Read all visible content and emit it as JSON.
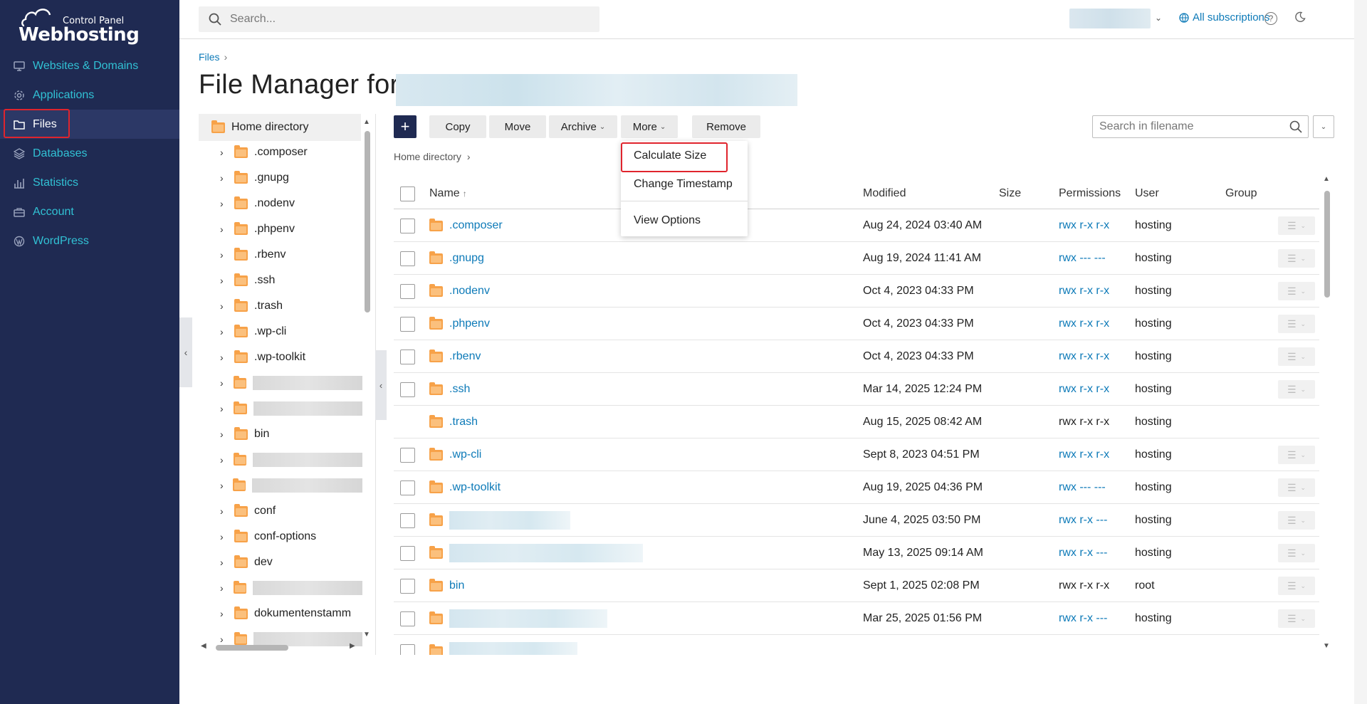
{
  "brand": {
    "line1": "Control Panel",
    "line2": "Webhosting"
  },
  "sidebar": {
    "items": [
      {
        "label": "Websites & Domains",
        "icon": "monitor-icon"
      },
      {
        "label": "Applications",
        "icon": "gear-icon"
      },
      {
        "label": "Files",
        "icon": "folder-icon",
        "active": true
      },
      {
        "label": "Databases",
        "icon": "layers-icon"
      },
      {
        "label": "Statistics",
        "icon": "bar-chart-icon"
      },
      {
        "label": "Account",
        "icon": "briefcase-icon"
      },
      {
        "label": "WordPress",
        "icon": "wordpress-icon"
      }
    ]
  },
  "topbar": {
    "search_placeholder": "Search...",
    "subscriptions_label": "All subscriptions"
  },
  "heading": {
    "breadcrumb": "Files",
    "title": "File Manager for"
  },
  "tree": {
    "root": "Home directory",
    "items": [
      ".composer",
      ".gnupg",
      ".nodenv",
      ".phpenv",
      ".rbenv",
      ".ssh",
      ".trash",
      ".wp-cli",
      ".wp-toolkit",
      "",
      "",
      "bin",
      "",
      "",
      "conf",
      "conf-options",
      "dev",
      "",
      "dokumentenstamm",
      ""
    ]
  },
  "toolbar": {
    "add_label": "+",
    "copy": "Copy",
    "move": "Move",
    "archive": "Archive",
    "more": "More",
    "remove": "Remove",
    "filename_search_placeholder": "Search in filename"
  },
  "path": {
    "current": "Home directory"
  },
  "table": {
    "headers": {
      "name": "Name",
      "sort_arrow": "↑",
      "modified": "Modified",
      "size": "Size",
      "permissions": "Permissions",
      "user": "User",
      "group": "Group"
    },
    "rows": [
      {
        "name": ".composer",
        "modified": "Aug 24, 2024 03:40 AM",
        "permissions": "rwx r-x r-x",
        "user": "hosting"
      },
      {
        "name": ".gnupg",
        "modified": "Aug 19, 2024 11:41 AM",
        "permissions": "rwx --- ---",
        "user": "hosting"
      },
      {
        "name": ".nodenv",
        "modified": "Oct 4, 2023 04:33 PM",
        "permissions": "rwx r-x r-x",
        "user": "hosting"
      },
      {
        "name": ".phpenv",
        "modified": "Oct 4, 2023 04:33 PM",
        "permissions": "rwx r-x r-x",
        "user": "hosting"
      },
      {
        "name": ".rbenv",
        "modified": "Oct 4, 2023 04:33 PM",
        "permissions": "rwx r-x r-x",
        "user": "hosting"
      },
      {
        "name": ".ssh",
        "modified": "Mar 14, 2025 12:24 PM",
        "permissions": "rwx r-x r-x",
        "user": "hosting"
      },
      {
        "name": ".trash",
        "modified": "Aug 15, 2025 08:42 AM",
        "permissions": "rwx r-x r-x",
        "user": "hosting"
      },
      {
        "name": ".wp-cli",
        "modified": "Sept 8, 2023 04:51 PM",
        "permissions": "rwx r-x r-x",
        "user": "hosting"
      },
      {
        "name": ".wp-toolkit",
        "modified": "Aug 19, 2025 04:36 PM",
        "permissions": "rwx --- ---",
        "user": "hosting"
      },
      {
        "name": "",
        "modified": "June 4, 2025 03:50 PM",
        "permissions": "rwx r-x ---",
        "user": "hosting"
      },
      {
        "name": "",
        "modified": "May 13, 2025 09:14 AM",
        "permissions": "rwx r-x ---",
        "user": "hosting"
      },
      {
        "name": "bin",
        "modified": "Sept 1, 2025 02:08 PM",
        "permissions": "rwx r-x r-x",
        "user": "root"
      },
      {
        "name": "",
        "modified": "Mar 25, 2025 01:56 PM",
        "permissions": "rwx r-x ---",
        "user": "hosting"
      }
    ]
  },
  "more_menu": {
    "items": [
      "Calculate Size",
      "Change Timestamp",
      "View Options"
    ]
  },
  "colors": {
    "sidebar_bg": "#1f2a52",
    "accent_link": "#0d7ab8",
    "nav_link": "#31c1d4",
    "highlight": "#e0242d",
    "folder": "#f7a249"
  }
}
